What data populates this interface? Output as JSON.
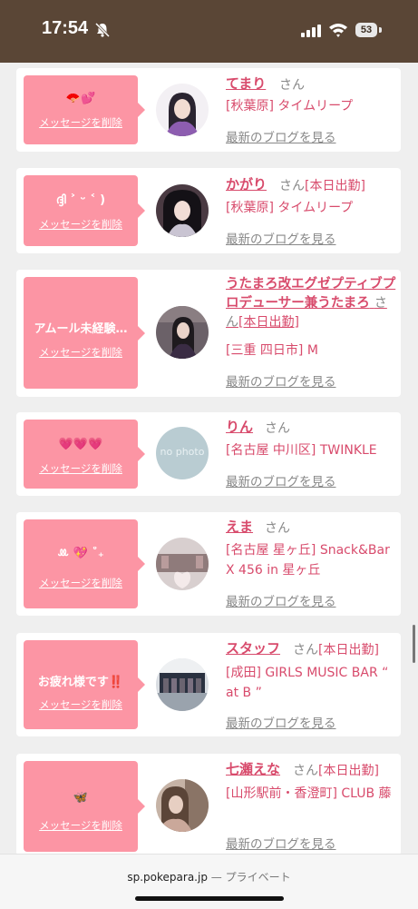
{
  "status_bar": {
    "time": "17:54",
    "battery": "53"
  },
  "cards": [
    {
      "message": "🪭💕",
      "delete_label": "メッセージを削除",
      "name": "てまり",
      "honorific": "さん",
      "badge": "",
      "shop": "[秋葉原] タイムリープ",
      "blog_link": "最新のブログを見る",
      "avatar": "photo-purple"
    },
    {
      "message": "ദ്ദി ˃ ᵕ ˂ )",
      "delete_label": "メッセージを削除",
      "name": "かがり",
      "honorific": "さん",
      "badge": "[本日出勤]",
      "shop": "[秋葉原] タイムリープ",
      "blog_link": "最新のブログを見る",
      "avatar": "photo-dark"
    },
    {
      "message": "アムール未経験…",
      "delete_label": "メッセージを削除",
      "name": "うたまろ改エグゼプティブプロデューサー兼うたまろ",
      "honorific": "さん",
      "badge": "[本日出勤]",
      "shop": "[三重 四日市] M",
      "blog_link": "最新のブログを見る",
      "avatar": "photo-kimono"
    },
    {
      "message": "💗💗💗",
      "delete_label": "メッセージを削除",
      "name": "りん",
      "honorific": "さん",
      "badge": "",
      "shop": "[名古屋 中川区] TWINKLE",
      "blog_link": "最新のブログを見る",
      "avatar": "no-photo",
      "avatar_text": "no photo"
    },
    {
      "message": "ꔛ 💖 ˚₊",
      "delete_label": "メッセージを削除",
      "name": "えま",
      "honorific": "さん",
      "badge": "",
      "shop": "[名古屋 星ヶ丘] Snack&Bar X 456 in 星ヶ丘",
      "blog_link": "最新のブログを見る",
      "avatar": "photo-bar"
    },
    {
      "message": "お疲れ様です‼️",
      "delete_label": "メッセージを削除",
      "name": "スタッフ",
      "honorific": "さん",
      "badge": "[本日出勤]",
      "shop": "[成田] GIRLS MUSIC BAR “ at B ”",
      "blog_link": "最新のブログを見る",
      "avatar": "photo-group"
    },
    {
      "message": "🦋",
      "delete_label": "メッセージを削除",
      "name": "七瀬えな",
      "honorific": "さん",
      "badge": "[本日出勤]",
      "shop": "[山形駅前・香澄町] CLUB 藤",
      "blog_link": "最新のブログを見る",
      "avatar": "photo-selfie"
    }
  ],
  "browser": {
    "domain": "sp.pokepara.jp",
    "separator": "—",
    "mode": "プライベート"
  }
}
